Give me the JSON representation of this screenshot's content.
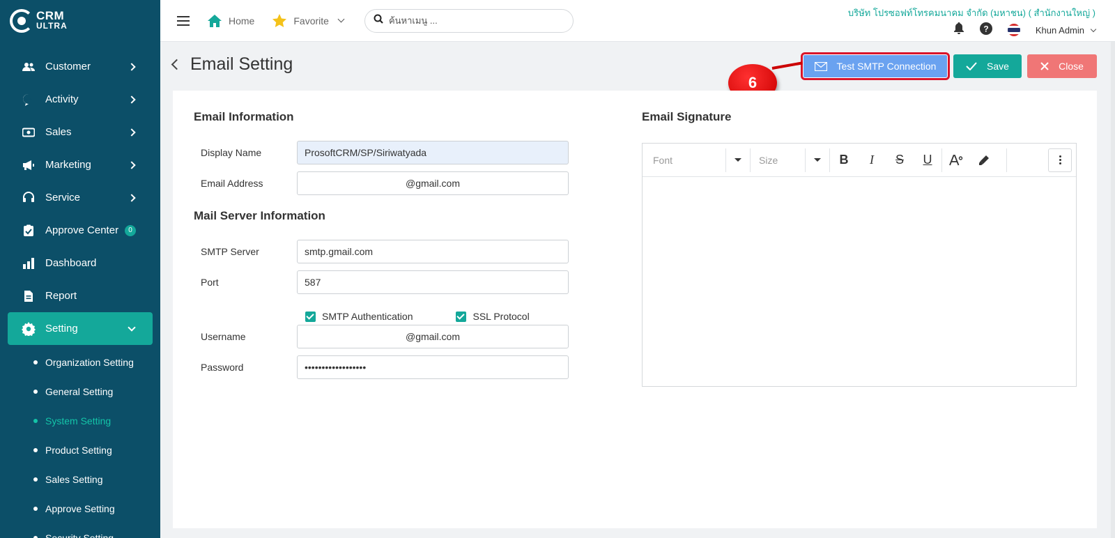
{
  "brand": {
    "line1": "CRM",
    "line2": "ULTRA"
  },
  "sidebar": {
    "items": [
      {
        "label": "Customer",
        "icon": "users-icon"
      },
      {
        "label": "Activity",
        "icon": "chat-icon"
      },
      {
        "label": "Sales",
        "icon": "cash-icon"
      },
      {
        "label": "Marketing",
        "icon": "megaphone-icon"
      },
      {
        "label": "Service",
        "icon": "headset-icon"
      },
      {
        "label": "Approve Center",
        "icon": "clipboard-check-icon",
        "badge": "0"
      },
      {
        "label": "Dashboard",
        "icon": "bar-chart-icon"
      },
      {
        "label": "Report",
        "icon": "document-icon"
      },
      {
        "label": "Setting",
        "icon": "gear-icon"
      }
    ],
    "subitems": [
      {
        "label": "Organization Setting"
      },
      {
        "label": "General Setting"
      },
      {
        "label": "System Setting"
      },
      {
        "label": "Product Setting"
      },
      {
        "label": "Sales Setting"
      },
      {
        "label": "Approve Setting"
      },
      {
        "label": "Security Setting"
      }
    ]
  },
  "topbar": {
    "home_label": "Home",
    "favorite_label": "Favorite",
    "search_placeholder": "ค้นหาเมนู ...",
    "company": "บริษัท โปรซอฟท์โทรคมนาคม จำกัด (มหาชน) ( สำนักงานใหญ่ )",
    "user": "Khun Admin"
  },
  "page": {
    "title": "Email Setting",
    "buttons": {
      "test_smtp": "Test SMTP Connection",
      "save": "Save",
      "close": "Close"
    },
    "callout": "6"
  },
  "form": {
    "email_info_title": "Email Information",
    "display_name_label": "Display Name",
    "display_name_value": "ProsoftCRM/SP/Siriwatyada",
    "email_address_label": "Email Address",
    "email_address_value": "@gmail.com",
    "mail_server_title": "Mail Server Information",
    "smtp_server_label": "SMTP Server",
    "smtp_server_value": "smtp.gmail.com",
    "port_label": "Port",
    "port_value": "587",
    "smtp_auth_label": "SMTP Authentication",
    "ssl_label": "SSL Protocol",
    "username_label": "Username",
    "username_value": "@gmail.com",
    "password_label": "Password",
    "password_value": "••••••••••••••••••"
  },
  "signature": {
    "title": "Email Signature",
    "font_placeholder": "Font",
    "size_placeholder": "Size"
  },
  "colors": {
    "sidebar": "#0c4f68",
    "accent": "#14a89a",
    "test_button": "#6aa2f0",
    "close_button": "#f07676",
    "highlight": "#d9152a"
  }
}
